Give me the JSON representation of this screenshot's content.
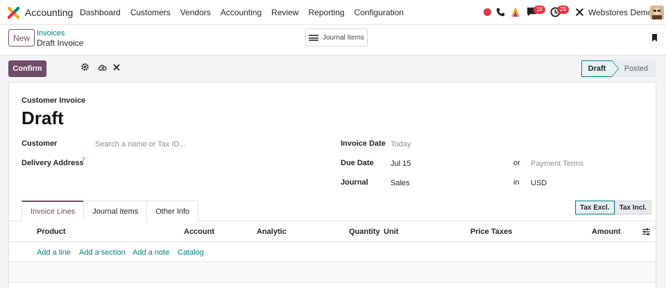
{
  "app": {
    "name": "Accounting",
    "icon": "odoo-accounting-logo"
  },
  "menu": [
    "Dashboard",
    "Customers",
    "Vendors",
    "Accounting",
    "Review",
    "Reporting",
    "Configuration"
  ],
  "systray": {
    "messages_badge": "18",
    "activities_badge": "29",
    "company": "Webstores Demo"
  },
  "control_panel": {
    "new_label": "New",
    "breadcrumb_parent": "Invoices",
    "breadcrumb_current": "Draft Invoice",
    "journal_items_label": "Journal Items"
  },
  "actions": {
    "confirm_label": "Confirm"
  },
  "statusbar": {
    "current": "Draft",
    "next": "Posted"
  },
  "form": {
    "type_label": "Customer Invoice",
    "title": "Draft",
    "customer_label": "Customer",
    "customer_placeholder": "Search a name or Tax ID...",
    "delivery_label": "Delivery Address",
    "delivery_help": "?",
    "invoice_date_label": "Invoice Date",
    "invoice_date_placeholder": "Today",
    "due_date_label": "Due Date",
    "due_date_value": "Jul 15",
    "or_label": "or",
    "payment_terms_placeholder": "Payment Terms",
    "journal_label": "Journal",
    "journal_value": "Sales",
    "in_label": "in",
    "currency_value": "USD"
  },
  "tabs": [
    "Invoice Lines",
    "Journal Items",
    "Other Info"
  ],
  "tax_toggle": {
    "excl": "Tax Excl.",
    "incl": "Tax Incl."
  },
  "table": {
    "headers": [
      "Product",
      "Account",
      "Analytic",
      "Quantity",
      "Unit",
      "Price",
      "Taxes",
      "Amount"
    ],
    "add_links": [
      "Add a line",
      "Add a section",
      "Add a note",
      "Catalog"
    ]
  },
  "colors": {
    "brand": "#714b67",
    "accent": "#017e84",
    "badge": "#e4343f"
  }
}
